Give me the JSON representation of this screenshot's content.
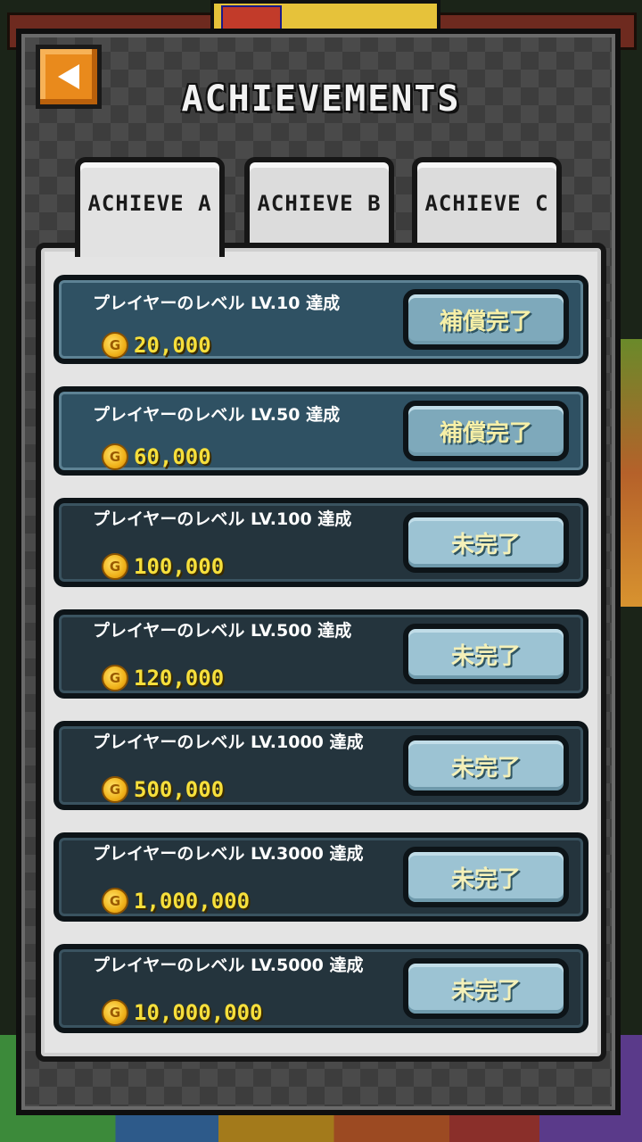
{
  "header": {
    "title": "ACHIEVEMENTS",
    "back_icon": "arrow-left-icon"
  },
  "tabs": [
    {
      "label": "ACHIEVE A",
      "active": true
    },
    {
      "label": "ACHIEVE B",
      "active": false
    },
    {
      "label": "ACHIEVE C",
      "active": false
    }
  ],
  "achievements": [
    {
      "title": "プレイヤーのレベル LV.10 達成",
      "reward": "20,000",
      "status": "補償完了",
      "completed": true
    },
    {
      "title": "プレイヤーのレベル LV.50 達成",
      "reward": "60,000",
      "status": "補償完了",
      "completed": true
    },
    {
      "title": "プレイヤーのレベル LV.100 達成",
      "reward": "100,000",
      "status": "未完了",
      "completed": false
    },
    {
      "title": "プレイヤーのレベル LV.500 達成",
      "reward": "120,000",
      "status": "未完了",
      "completed": false
    },
    {
      "title": "プレイヤーのレベル LV.1000 達成",
      "reward": "500,000",
      "status": "未完了",
      "completed": false
    },
    {
      "title": "プレイヤーのレベル LV.3000 達成",
      "reward": "1,000,000",
      "status": "未完了",
      "completed": false
    },
    {
      "title": "プレイヤーのレベル LV.5000 達成",
      "reward": "10,000,000",
      "status": "未完了",
      "completed": false
    }
  ],
  "coin_icon": "coin-icon",
  "coin_symbol": "G",
  "colors": {
    "panel": "#4a4a4a",
    "card_done": "#2f5163",
    "card_pending": "#24343d",
    "reward_text": "#f6df3c",
    "back_button": "#e98a1c"
  }
}
